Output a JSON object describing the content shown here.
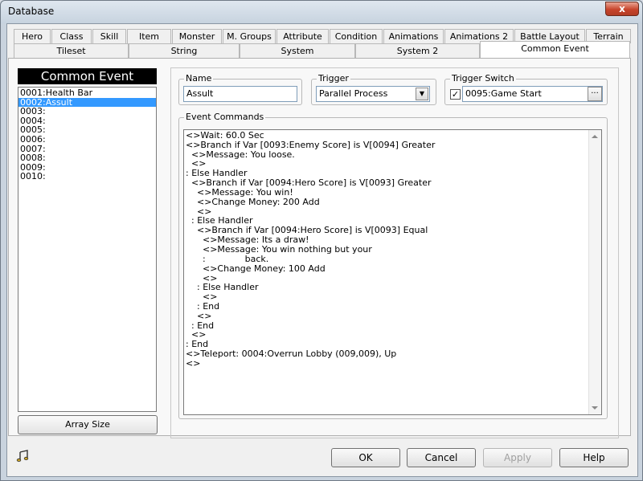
{
  "window": {
    "title": "Database",
    "close_glyph": "x"
  },
  "tabs_row1": [
    "Hero",
    "Class",
    "Skill",
    "Item",
    "Monster",
    "M. Groups",
    "Attribute",
    "Condition",
    "Animations",
    "Animations 2",
    "Battle Layout",
    "Terrain"
  ],
  "tabs_row2": [
    "Tileset",
    "String",
    "System",
    "System 2",
    "Common Event"
  ],
  "active_tab": "Common Event",
  "common_event": {
    "header": "Common Event",
    "items": [
      "0001:Health Bar",
      "0002:Assult",
      "0003:",
      "0004:",
      "0005:",
      "0006:",
      "0007:",
      "0008:",
      "0009:",
      "0010:"
    ],
    "selected_index": 1,
    "array_size_label": "Array Size"
  },
  "name": {
    "label": "Name",
    "value": "Assult"
  },
  "trigger": {
    "label": "Trigger",
    "value": "Parallel Process"
  },
  "trigger_switch": {
    "label": "Trigger Switch",
    "checked": true,
    "check_glyph": "✓",
    "value": "0095:Game Start",
    "browse_label": "..."
  },
  "event_commands": {
    "label": "Event Commands",
    "lines": [
      "<>Wait: 60.0 Sec",
      "<>Branch if Var [0093:Enemy Score] is V[0094] Greater",
      "  <>Message: You loose.",
      "  <>",
      ": Else Handler",
      "  <>Branch if Var [0094:Hero Score] is V[0093] Greater",
      "    <>Message: You win!",
      "    <>Change Money: 200 Add",
      "    <>",
      "  : Else Handler",
      "    <>Branch if Var [0094:Hero Score] is V[0093] Equal",
      "      <>Message: Its a draw!",
      "      <>Message: You win nothing but your",
      "      :              back.",
      "      <>Change Money: 100 Add",
      "      <>",
      "    : Else Handler",
      "      <>",
      "    : End",
      "    <>",
      "  : End",
      "  <>",
      ": End",
      "<>Teleport: 0004:Overrun Lobby (009,009), Up",
      "<>"
    ]
  },
  "buttons": {
    "ok": "OK",
    "cancel": "Cancel",
    "apply": "Apply",
    "help": "Help"
  },
  "icons": {
    "close": "close-icon",
    "music": "music-note-icon",
    "combo": "chevron-down-icon",
    "scroll_up": "scroll-up-icon",
    "scroll_down": "scroll-down-icon"
  },
  "colors": {
    "selection": "#3399ff",
    "header_bg": "#000000",
    "close_btn": "#c7452c"
  }
}
